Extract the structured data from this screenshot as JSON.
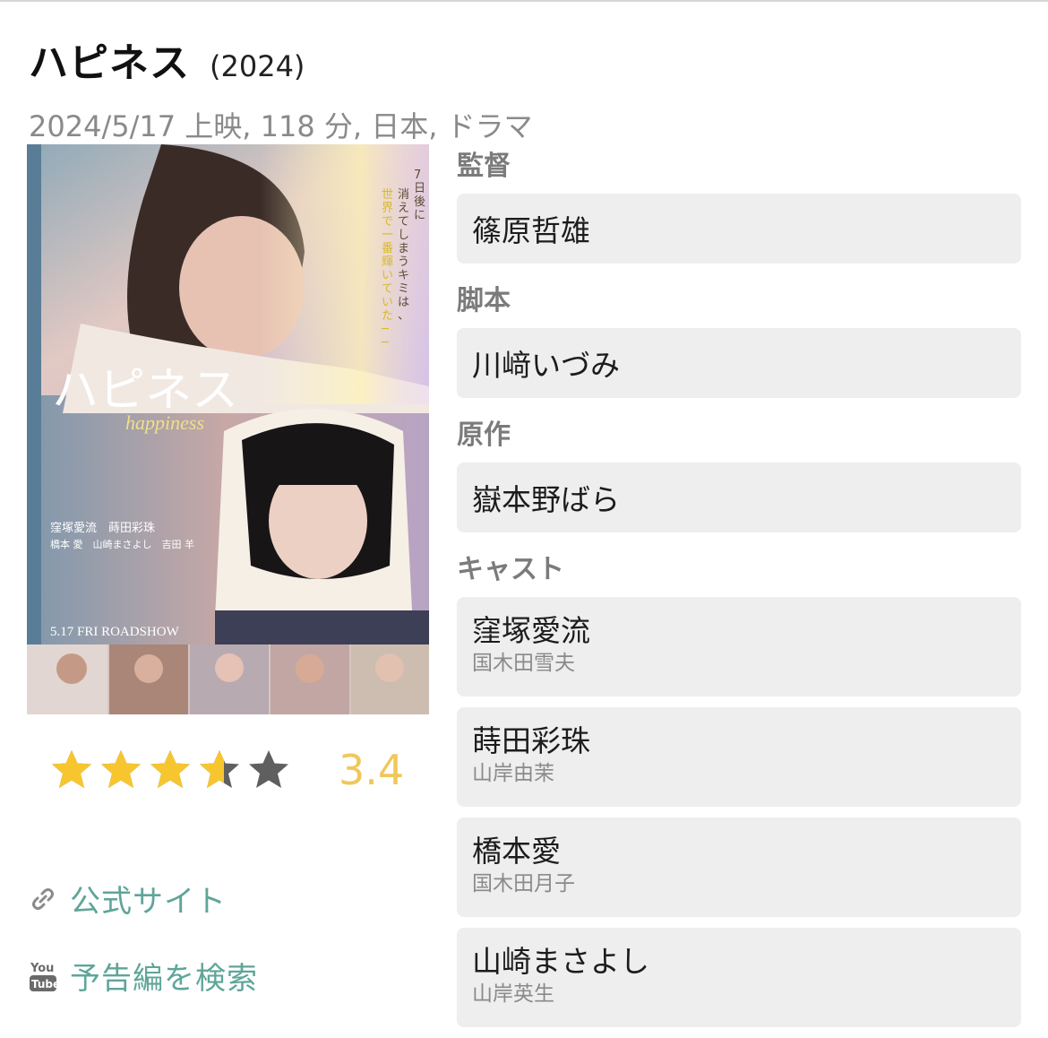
{
  "movie": {
    "title": "ハピネス",
    "year": "(2024)",
    "meta": "2024/5/17 上映, 118 分, 日本, ドラマ"
  },
  "poster": {
    "tagline_lines": [
      "7日後に",
      "消えてしまうキミは、",
      "世界で一番輝いていた──"
    ],
    "title_text": "ハピネス",
    "subtitle_script": "happiness",
    "release_text": "5.17 FRI ROADSHOW",
    "cast_line1": "窪塚愛流　蒔田彩珠",
    "cast_line2": "橋本 愛　山崎まさよし　吉田 羊"
  },
  "rating": {
    "value": 3.4,
    "max": 5,
    "score_text": "3.4",
    "filled_color": "#f7c62f",
    "empty_color": "#5f5f5f"
  },
  "links": {
    "official_site": "公式サイト",
    "trailer_search": "予告編を検索",
    "official_site_icon": "link-icon",
    "trailer_icon": "youtube-icon"
  },
  "credits": {
    "director_label": "監督",
    "director": "篠原哲雄",
    "screenplay_label": "脚本",
    "screenplay": "川﨑いづみ",
    "original_label": "原作",
    "original": "嶽本野ばら",
    "cast_label": "キャスト",
    "cast": [
      {
        "actor": "窪塚愛流",
        "role": "国木田雪夫"
      },
      {
        "actor": "蒔田彩珠",
        "role": "山岸由茉"
      },
      {
        "actor": "橋本愛",
        "role": "国木田月子"
      },
      {
        "actor": "山崎まさよし",
        "role": "山岸英生"
      }
    ]
  }
}
